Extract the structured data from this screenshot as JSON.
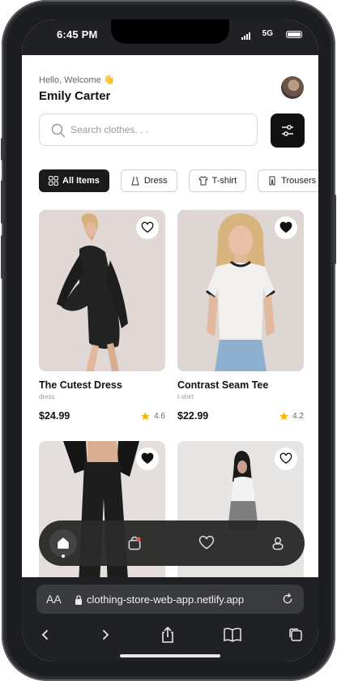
{
  "status_bar": {
    "time": "6:45 PM",
    "network": "5G"
  },
  "header": {
    "greeting": "Hello, Welcome 👋",
    "user_name": "Emily Carter"
  },
  "search": {
    "placeholder": "Search clothes. . ."
  },
  "categories": [
    {
      "label": "All Items",
      "icon": "grid-icon",
      "active": true
    },
    {
      "label": "Dress",
      "icon": "dress-icon",
      "active": false
    },
    {
      "label": "T-shirt",
      "icon": "tshirt-icon",
      "active": false
    },
    {
      "label": "Trousers",
      "icon": "trousers-icon",
      "active": false
    }
  ],
  "products": [
    {
      "title": "The Cutest Dress",
      "category": "dress",
      "price": "$24.99",
      "rating": "4.6",
      "favorited": false
    },
    {
      "title": "Contrast Seam Tee",
      "category": "t-shirt",
      "price": "$22.99",
      "rating": "4.2",
      "favorited": true
    },
    {
      "title": "",
      "category": "",
      "price": "",
      "rating": "",
      "favorited": true
    },
    {
      "title": "",
      "category": "",
      "price": "",
      "rating": "",
      "favorited": false
    }
  ],
  "bottom_nav": [
    {
      "icon": "home-icon",
      "active": true
    },
    {
      "icon": "shopping-bag-icon",
      "active": false
    },
    {
      "icon": "heart-icon",
      "active": false
    },
    {
      "icon": "user-icon",
      "active": false
    }
  ],
  "browser": {
    "text_size_label": "AA",
    "url": "clothing-store-web-app.netlify.app"
  },
  "colors": {
    "accent": "#111111",
    "star": "#f5b800",
    "browser_bg": "#202124"
  }
}
